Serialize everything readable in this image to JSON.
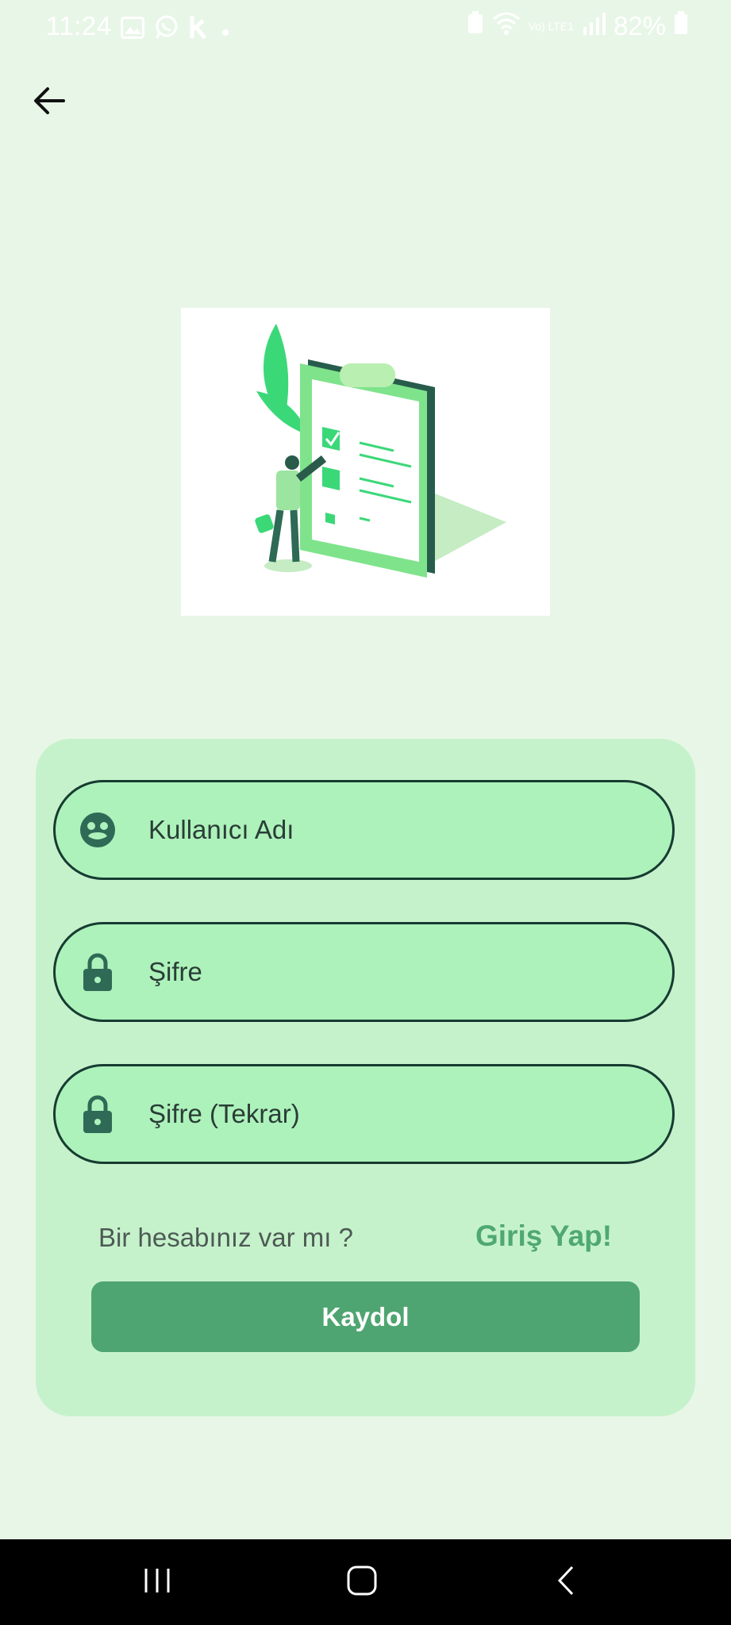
{
  "status_bar": {
    "time": "11:24",
    "battery_percent": "82%",
    "network_label": "Vo) LTE1",
    "left_icons": [
      "gallery-icon",
      "whatsapp-icon",
      "k-app-icon",
      "dot-icon"
    ],
    "right_icons": [
      "battery-saver-icon",
      "wifi-icon",
      "volte-icon",
      "signal-icon",
      "battery-icon"
    ]
  },
  "header": {
    "back_icon": "arrow-left-icon"
  },
  "illustration": {
    "description_icon": "clipboard-checklist-illustration"
  },
  "form": {
    "username": {
      "placeholder": "Kullanıcı Adı",
      "icon": "user-face-icon",
      "value": ""
    },
    "password": {
      "placeholder": "Şifre",
      "icon": "lock-icon",
      "value": ""
    },
    "password_repeat": {
      "placeholder": "Şifre (Tekrar)",
      "icon": "lock-icon",
      "value": ""
    },
    "login_question": "Bir hesabınız var mı ?",
    "login_link": "Giriş Yap!",
    "submit_label": "Kaydol"
  },
  "nav": {
    "recents_icon": "recents-icon",
    "home_icon": "home-icon",
    "back_icon": "back-chevron-icon"
  },
  "colors": {
    "background": "#e8f6e7",
    "card": "#c6f2cb",
    "field": "#adf2bb",
    "field_border": "#173b31",
    "accent": "#4fa571",
    "link": "#4fa872",
    "icon": "#2e6a55"
  }
}
